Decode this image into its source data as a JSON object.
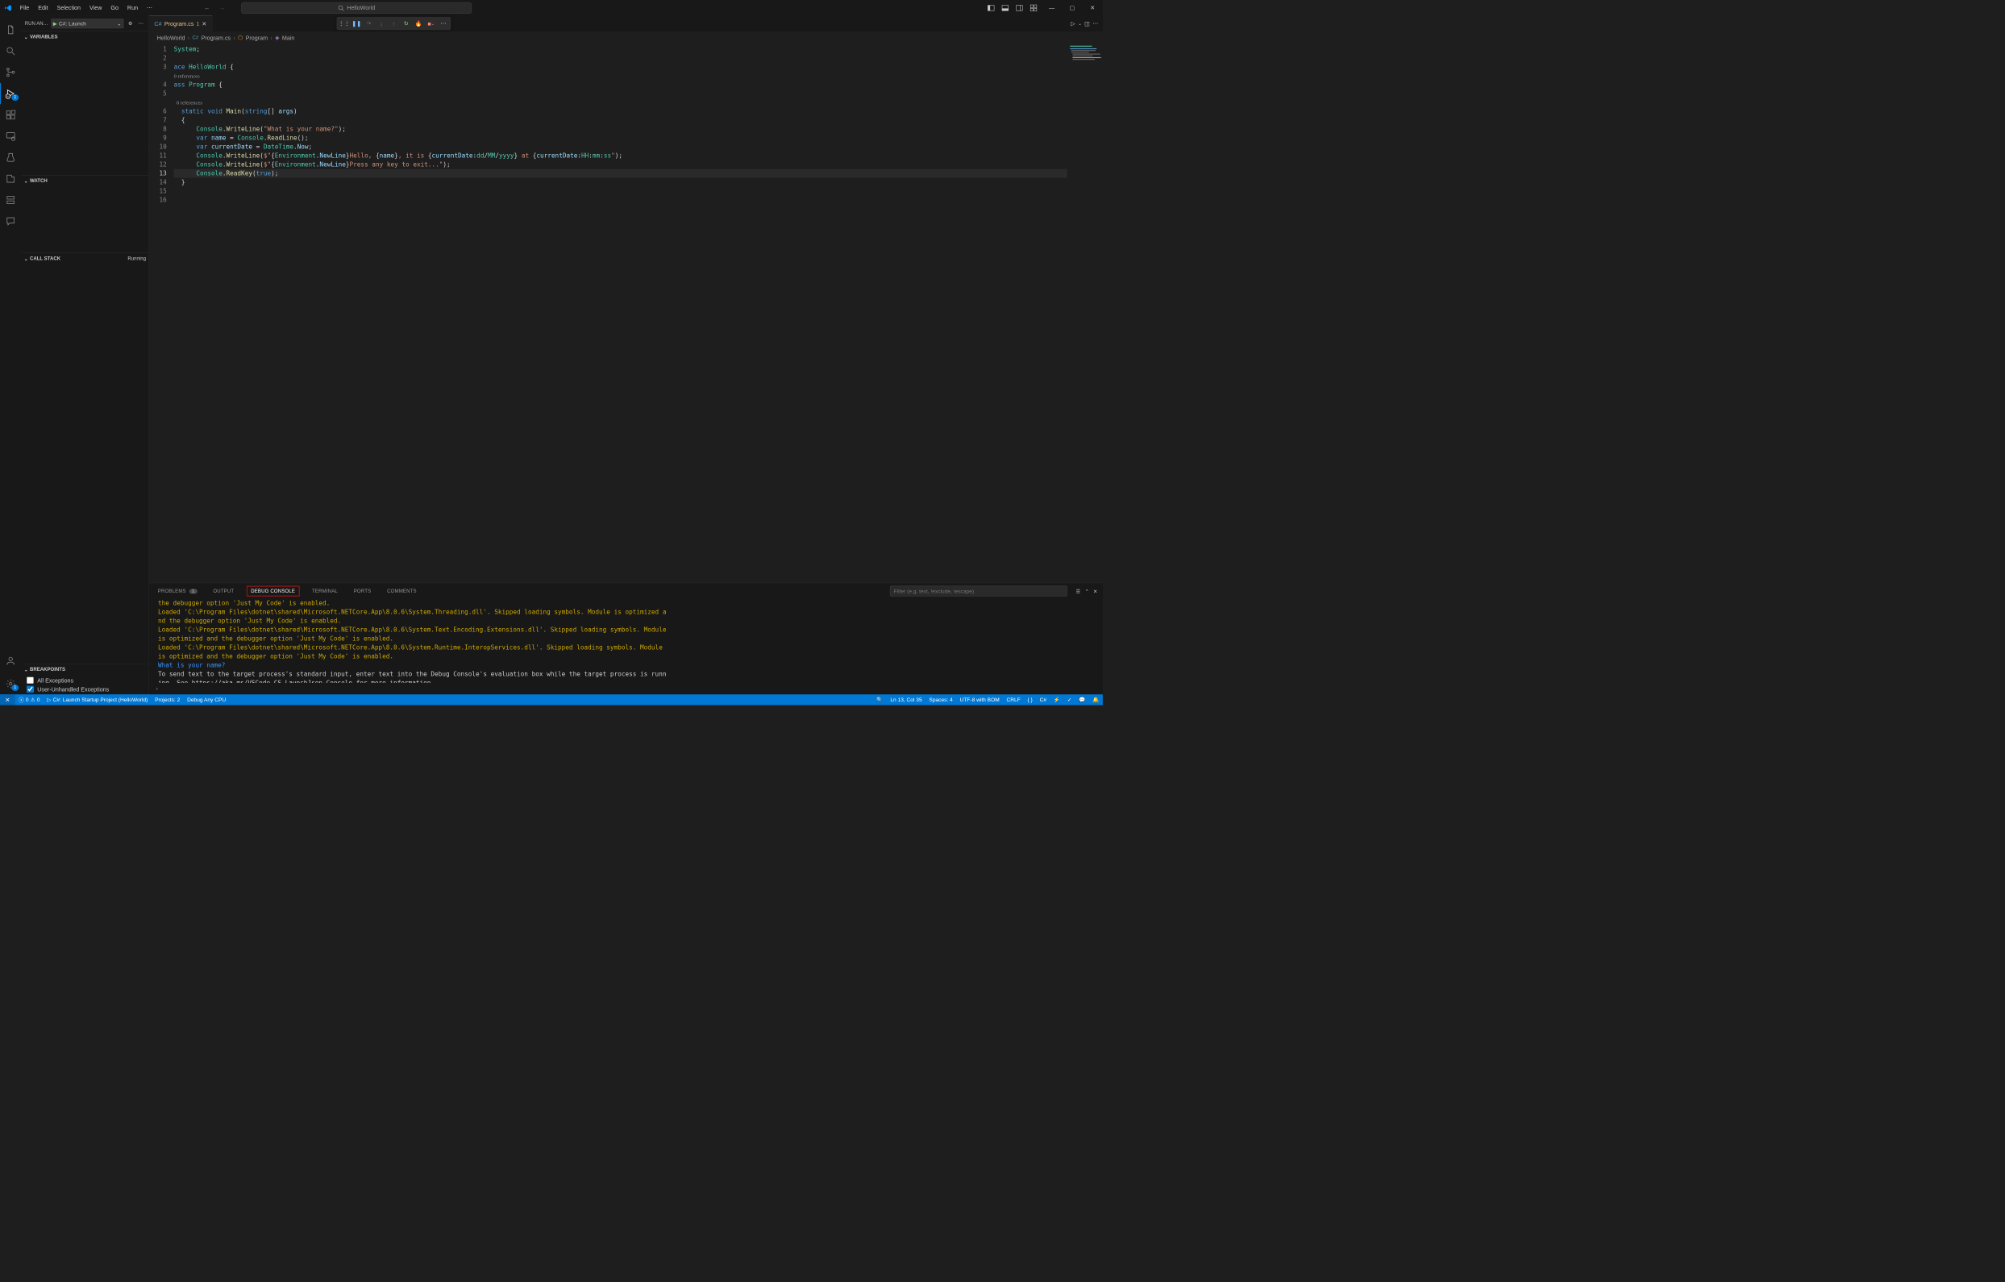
{
  "menu": {
    "file": "File",
    "edit": "Edit",
    "selection": "Selection",
    "view": "View",
    "go": "Go",
    "run": "Run"
  },
  "search_text": "HelloWorld",
  "run_debug_title": "RUN AN…",
  "launch_config": "C#: Launch",
  "sections": {
    "variables": "VARIABLES",
    "watch": "WATCH",
    "callstack": "CALL STACK",
    "callstack_status": "Running",
    "breakpoints": "BREAKPOINTS"
  },
  "breakpoints": {
    "all": "All Exceptions",
    "user": "User-Unhandled Exceptions"
  },
  "tab": {
    "name": "Program.cs",
    "dirty": "1"
  },
  "breadcrumb": {
    "p1": "HelloWorld",
    "p2": "Program.cs",
    "p3": "Program",
    "p4": "Main"
  },
  "codelens": "0 references",
  "code_lines": [
    {
      "n": 1,
      "html": "<span class='tok-type'>System</span><span class='tok-punc'>;</span>"
    },
    {
      "n": 2,
      "html": ""
    },
    {
      "n": 3,
      "html": "<span class='tok-kw'>ace</span> <span class='tok-type'>HelloWorld</span> <span class='tok-punc'>{</span>"
    },
    {
      "n": "cl",
      "html": "0 references"
    },
    {
      "n": 4,
      "html": "<span class='tok-kw'>ass</span> <span class='tok-type'>Program</span> <span class='tok-punc'>{</span>"
    },
    {
      "n": 5,
      "html": ""
    },
    {
      "n": "cl",
      "html": "  0 references"
    },
    {
      "n": 6,
      "html": "  <span class='tok-kw'>static</span> <span class='tok-kw'>void</span> <span class='tok-func'>Main</span><span class='tok-punc'>(</span><span class='tok-kw'>string</span><span class='tok-punc'>[]</span> <span class='tok-var'>args</span><span class='tok-punc'>)</span>"
    },
    {
      "n": 7,
      "html": "  <span class='tok-punc'>{</span>"
    },
    {
      "n": 8,
      "html": "      <span class='tok-type'>Console</span><span class='tok-punc'>.</span><span class='tok-func'>WriteLine</span><span class='tok-punc'>(</span><span class='tok-str'>\"What is your name?\"</span><span class='tok-punc'>);</span>"
    },
    {
      "n": 9,
      "html": "      <span class='tok-kw'>var</span> <span class='tok-var'>name</span> <span class='tok-punc'>=</span> <span class='tok-type'>Console</span><span class='tok-punc'>.</span><span class='tok-func'>ReadLine</span><span class='tok-punc'>();</span>"
    },
    {
      "n": 10,
      "html": "      <span class='tok-kw'>var</span> <span class='tok-var'>currentDate</span> <span class='tok-punc'>=</span> <span class='tok-type'>DateTime</span><span class='tok-punc'>.</span><span class='tok-var'>Now</span><span class='tok-punc'>;</span>"
    },
    {
      "n": 11,
      "html": "      <span class='tok-type'>Console</span><span class='tok-punc'>.</span><span class='tok-func'>WriteLine</span><span class='tok-punc'>(</span><span class='tok-str'>$\"</span><span class='tok-punc'>{</span><span class='tok-type'>Environment</span><span class='tok-punc'>.</span><span class='tok-var'>NewLine</span><span class='tok-punc'>}</span><span class='tok-str'>Hello, </span><span class='tok-punc'>{</span><span class='tok-var'>name</span><span class='tok-punc'>}</span><span class='tok-str'>, it is </span><span class='tok-punc'>{</span><span class='tok-var'>currentDate</span><span class='tok-punc'>:</span><span class='tok-type'>dd</span><span class='tok-punc'>/</span><span class='tok-type'>MM</span><span class='tok-punc'>/</span><span class='tok-type'>yyyy</span><span class='tok-punc'>}</span><span class='tok-str'> at </span><span class='tok-punc'>{</span><span class='tok-var'>currentDate</span><span class='tok-punc'>:</span><span class='tok-type'>HH</span><span class='tok-punc'>:</span><span class='tok-type'>mm</span><span class='tok-punc'>:</span><span class='tok-type'>ss</span><span class='tok-str'>\"</span><span class='tok-punc'>);</span>"
    },
    {
      "n": 12,
      "html": "      <span class='tok-type'>Console</span><span class='tok-punc'>.</span><span class='tok-func'>WriteLine</span><span class='tok-punc'>(</span><span class='tok-str'>$\"</span><span class='tok-punc'>{</span><span class='tok-type'>Environment</span><span class='tok-punc'>.</span><span class='tok-var'>NewLine</span><span class='tok-punc'>}</span><span class='tok-str'>Press any key to exit...\"</span><span class='tok-punc'>);</span>"
    },
    {
      "n": 13,
      "html": "      <span class='tok-type'>Console</span><span class='tok-punc'>.</span><span class='tok-func'>ReadKey</span><span class='tok-punc'>(</span><span class='tok-kw'>true</span><span class='tok-punc'>);</span>",
      "current": true
    },
    {
      "n": 14,
      "html": "  <span class='tok-punc'>}</span>"
    },
    {
      "n": 15,
      "html": ""
    },
    {
      "n": 16,
      "html": ""
    }
  ],
  "panel_tabs": {
    "problems": "PROBLEMS",
    "problems_count": "1",
    "output": "OUTPUT",
    "debug_console": "DEBUG CONSOLE",
    "terminal": "TERMINAL",
    "ports": "PORTS",
    "comments": "COMMENTS"
  },
  "filter_placeholder": "Filter (e.g. text, !exclude, \\escape)",
  "console": [
    {
      "cls": "msg-warn",
      "text": "the debugger option 'Just My Code' is enabled."
    },
    {
      "cls": "msg-warn",
      "text": "Loaded 'C:\\Program Files\\dotnet\\shared\\Microsoft.NETCore.App\\8.0.6\\System.Threading.dll'. Skipped loading symbols. Module is optimized a"
    },
    {
      "cls": "msg-warn",
      "text": "nd the debugger option 'Just My Code' is enabled."
    },
    {
      "cls": "msg-warn",
      "text": "Loaded 'C:\\Program Files\\dotnet\\shared\\Microsoft.NETCore.App\\8.0.6\\System.Text.Encoding.Extensions.dll'. Skipped loading symbols. Module"
    },
    {
      "cls": "msg-warn",
      "text": "is optimized and the debugger option 'Just My Code' is enabled."
    },
    {
      "cls": "msg-warn",
      "text": "Loaded 'C:\\Program Files\\dotnet\\shared\\Microsoft.NETCore.App\\8.0.6\\System.Runtime.InteropServices.dll'. Skipped loading symbols. Module"
    },
    {
      "cls": "msg-warn",
      "text": "is optimized and the debugger option 'Just My Code' is enabled."
    },
    {
      "cls": "msg-info",
      "text": "What is your name?"
    },
    {
      "cls": "msg-plain",
      "text": "To send text to the target process's standard input, enter text into the Debug Console's evaluation box while the target process is runn"
    },
    {
      "cls": "msg-plain",
      "text": "ing. See https://aka.ms/VSCode-CS-LaunchJson-Console for more information."
    }
  ],
  "status": {
    "errors": "0",
    "warnings": "0",
    "project": "C#: Launch Startup Project (HelloWorld)",
    "projects": "Projects: 2",
    "config": "Debug Any CPU",
    "cursor": "Ln 13, Col 35",
    "spaces": "Spaces: 4",
    "encoding": "UTF-8 with BOM",
    "eol": "CRLF",
    "lang": "C#",
    "brackets": "{ }"
  },
  "debug_badge": "1",
  "settings_badge": "1"
}
